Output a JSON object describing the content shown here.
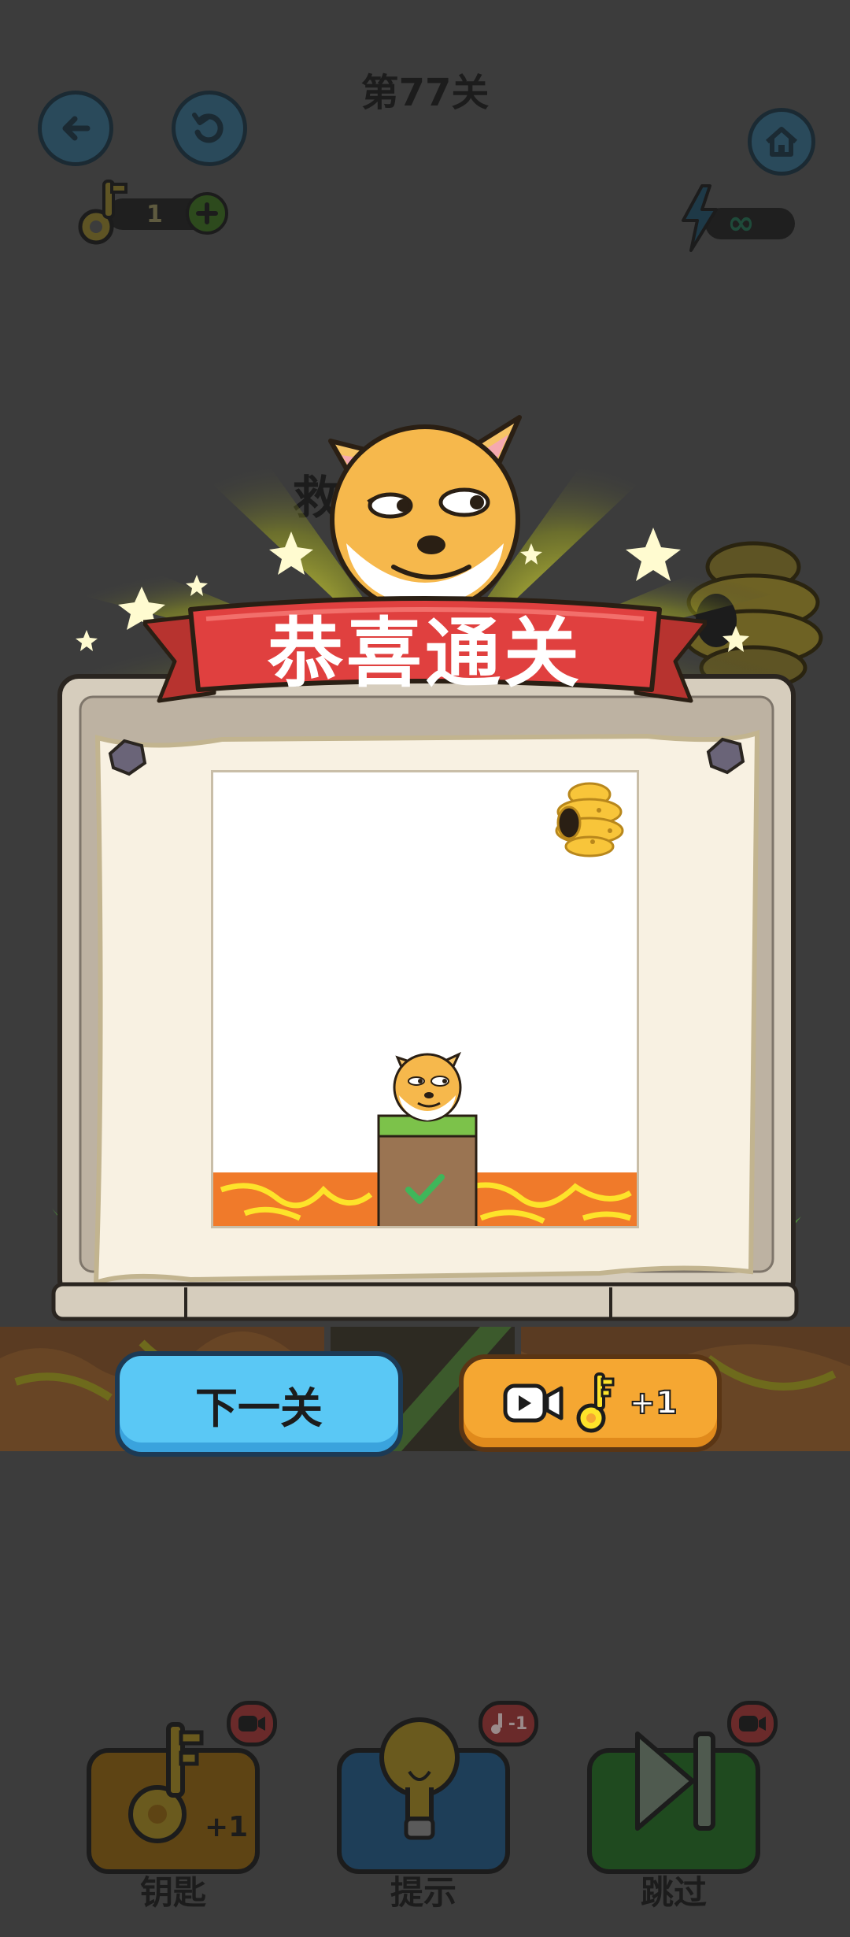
{
  "header": {
    "level_title": "第77关",
    "key_count": "1",
    "energy_value": "∞"
  },
  "background": {
    "hidden_hint_char": "救"
  },
  "celebration": {
    "banner_text": "恭喜通关"
  },
  "actions": {
    "next_label": "下一关",
    "reward_label": "+1"
  },
  "toolbar": {
    "items": [
      {
        "label": "钥匙",
        "badge": "+1"
      },
      {
        "label": "提示",
        "badge": "-1"
      },
      {
        "label": "跳过"
      }
    ]
  },
  "colors": {
    "background": "#3c3c3c",
    "banner_red": "#e0403f",
    "next_button_blue": "#5ac8f5",
    "reward_button_orange": "#f5a732",
    "lava_orange": "#f07a2a",
    "lava_yellow": "#fde32a",
    "grass_green": "#7cc24a",
    "dirt_brown": "#9a7452",
    "scroll_paper": "#f8f1e2",
    "stone_frame": "#d6cdbd"
  }
}
